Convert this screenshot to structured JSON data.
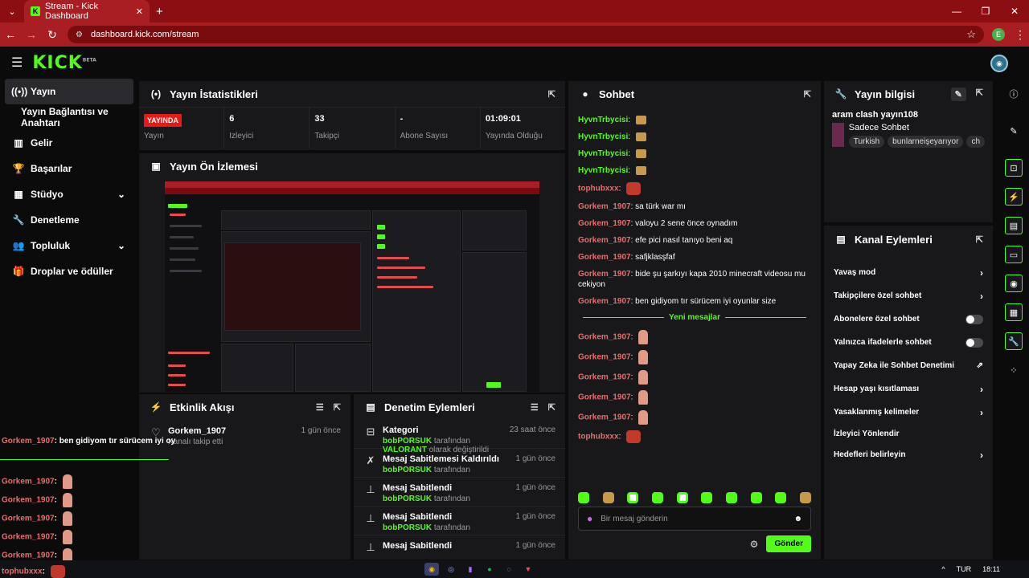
{
  "browser": {
    "tab_title": "Stream - Kick Dashboard",
    "url": "dashboard.kick.com/stream",
    "profile_initial": "E"
  },
  "logo": {
    "text": "KICK",
    "beta": "BETA"
  },
  "sidebar": {
    "items": [
      {
        "label": "Yayın",
        "icon": "broadcast-icon"
      },
      {
        "label": "Yayın Bağlantısı ve Anahtarı",
        "icon": ""
      },
      {
        "label": "Gelir",
        "icon": "revenue-icon"
      },
      {
        "label": "Başarılar",
        "icon": "trophy-icon"
      },
      {
        "label": "Stüdyo",
        "icon": "studio-icon"
      },
      {
        "label": "Denetleme",
        "icon": "wrench-icon"
      },
      {
        "label": "Topluluk",
        "icon": "community-icon"
      },
      {
        "label": "Droplar ve ödüller",
        "icon": "gift-icon"
      }
    ]
  },
  "stats": {
    "title": "Yayın İstatistikleri",
    "live_badge": "YAYINDA",
    "live_label": "Yayın",
    "items": [
      {
        "value": "6",
        "label": "İzleyici"
      },
      {
        "value": "33",
        "label": "Takipçi"
      },
      {
        "value": "-",
        "label": "Abone Sayısı"
      },
      {
        "value": "01:09:01",
        "label": "Yayında Olduğu Süre"
      }
    ]
  },
  "preview": {
    "title": "Yayın Ön İzlemesi"
  },
  "activity": {
    "title": "Etkinlik Akışı",
    "items": [
      {
        "user": "Gorkem_1907",
        "desc": "Kanalı takip etti",
        "time": "1 gün önce"
      }
    ]
  },
  "modlog": {
    "title": "Denetim Eylemleri",
    "items": [
      {
        "action": "Kategori",
        "user": "bobPORSUK",
        "text1": " tarafından ",
        "hl": "VALORANT",
        "text2": " olarak değiştirildi",
        "time": "23 saat önce",
        "icon": "category-icon"
      },
      {
        "action": "Mesaj Sabitlemesi Kaldırıldı",
        "user": "bobPORSUK",
        "text1": " tarafından",
        "hl": "",
        "text2": "",
        "time": "1 gün önce",
        "icon": "unpin-icon"
      },
      {
        "action": "Mesaj Sabitlendi",
        "user": "bobPORSUK",
        "text1": " tarafından",
        "hl": "",
        "text2": "",
        "time": "1 gün önce",
        "icon": "pin-icon"
      },
      {
        "action": "Mesaj Sabitlendi",
        "user": "bobPORSUK",
        "text1": " tarafından",
        "hl": "",
        "text2": "",
        "time": "1 gün önce",
        "icon": "pin-icon"
      },
      {
        "action": "Mesaj Sabitlendi",
        "user": "",
        "text1": "",
        "hl": "",
        "text2": "",
        "time": "1 gün önce",
        "icon": "pin-icon"
      }
    ]
  },
  "chat": {
    "title": "Sohbet",
    "messages": [
      {
        "user": "HyvnTrbycisi",
        "color": "green",
        "text": "",
        "emote": "box"
      },
      {
        "user": "HyvnTrbycisi",
        "color": "green",
        "text": "",
        "emote": "box"
      },
      {
        "user": "HyvnTrbycisi",
        "color": "green",
        "text": "",
        "emote": "box"
      },
      {
        "user": "HyvnTrbycisi",
        "color": "green",
        "text": "",
        "emote": "box"
      },
      {
        "user": "tophubxxx",
        "color": "red",
        "text": "",
        "emote": "face"
      },
      {
        "user": "Gorkem_1907",
        "color": "red",
        "text": "sa türk war mı",
        "emote": ""
      },
      {
        "user": "Gorkem_1907",
        "color": "red",
        "text": "valoyu 2 sene önce oynadım",
        "emote": ""
      },
      {
        "user": "Gorkem_1907",
        "color": "red",
        "text": "efe pici nasıl tanıyo beni aq",
        "emote": ""
      },
      {
        "user": "Gorkem_1907",
        "color": "red",
        "text": "safjklasşfaf",
        "emote": ""
      },
      {
        "user": "Gorkem_1907",
        "color": "red",
        "text": "bide şu şarkıyı kapa 2010 minecraft videosu mu cekiyon",
        "emote": ""
      },
      {
        "user": "Gorkem_1907",
        "color": "red",
        "text": "ben gidiyom tır sürücem iyi oyunlar size",
        "emote": ""
      }
    ],
    "new_label": "Yeni mesajlar",
    "new_messages": [
      {
        "user": "Gorkem_1907",
        "emote": "hand"
      },
      {
        "user": "Gorkem_1907",
        "emote": "hand"
      },
      {
        "user": "Gorkem_1907",
        "emote": "hand"
      },
      {
        "user": "Gorkem_1907",
        "emote": "hand"
      },
      {
        "user": "Gorkem_1907",
        "emote": "hand"
      },
      {
        "user": "tophubxxx",
        "emote": "face"
      }
    ],
    "input_placeholder": "Bir mesaj gönderin",
    "send_label": "Gönder"
  },
  "info": {
    "title": "Yayın bilgisi",
    "stream_title": "aram clash yayın108",
    "category": "Sadece Sohbet",
    "tags": [
      "Turkish",
      "bunlarneişeyarıyor",
      "ch"
    ]
  },
  "channel_actions": {
    "title": "Kanal Eylemleri",
    "items": [
      {
        "label": "Yavaş mod",
        "kind": "chevron"
      },
      {
        "label": "Takipçilere özel sohbet",
        "kind": "chevron"
      },
      {
        "label": "Abonelere özel sohbet",
        "kind": "toggle"
      },
      {
        "label": "Yalnızca ifadelerle sohbet",
        "kind": "toggle"
      },
      {
        "label": "Yapay Zeka ile Sohbet Denetimi",
        "kind": "external"
      },
      {
        "label": "Hesap yaşı kısıtlaması",
        "kind": "chevron"
      },
      {
        "label": "Yasaklanmış kelimeler",
        "kind": "chevron"
      },
      {
        "label": "İzleyici Yönlendir",
        "kind": "none"
      },
      {
        "label": "Hedefleri belirleyin",
        "kind": "chevron"
      }
    ]
  },
  "overlay": {
    "lead_user": "Gorkem_1907",
    "lead_text": ": ben gidiyom tır sürücem iyi oy",
    "users": [
      "Gorkem_1907",
      "Gorkem_1907",
      "Gorkem_1907",
      "Gorkem_1907",
      "Gorkem_1907",
      "tophubxxx"
    ]
  },
  "taskbar": {
    "lang": "TUR",
    "time": "18:11"
  },
  "colors": {
    "accent": "#53fc18",
    "live": "#e91916",
    "chrome": "#a91e22"
  }
}
